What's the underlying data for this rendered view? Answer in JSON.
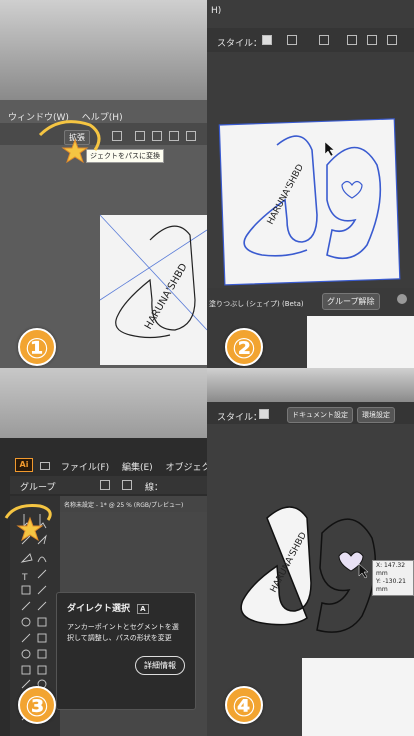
{
  "panel1": {
    "menu": [
      "ウィンドウ(W)",
      "ヘルプ(H)"
    ],
    "toolbar_button": "拡張",
    "tooltip": "ジェクトをパスに変換",
    "design_text": "HARUNA'SHBD",
    "number": "①"
  },
  "panel2": {
    "top_menu": "H)",
    "style_label": "スタイル：",
    "design_text": "HARUNA'SHBD",
    "bottom_label": "塗りつぶし (シェイプ) (Beta)",
    "ungroup_button": "グループ解除",
    "number": "②"
  },
  "panel3": {
    "menu": [
      "ファイル(F)",
      "編集(E)",
      "オブジェクト(O)"
    ],
    "group_label": "グループ",
    "doc_tab": "名称未設定 - 1* @ 25 % (RGB/プレビュー)",
    "stroke_label": "線：",
    "tooltip_title": "ダイレクト選択",
    "tooltip_key": "A",
    "tooltip_body": "アンカーポイントとセグメントを選択して調整し、パスの形状を変更",
    "tooltip_button": "詳細情報",
    "app_icon": "Ai",
    "number": "③"
  },
  "panel4": {
    "style_label": "スタイル：",
    "doc_settings_button": "ドキュメント設定",
    "prefs_button": "環境設定",
    "design_text": "HARUNA'SHBD",
    "coord_x": "X: 147.32 mm",
    "coord_y": "Y: -130.21 mm",
    "number": "④"
  },
  "colors": {
    "badge": "#f2a431",
    "path_blue": "#3a5bd0",
    "sparkle": "#f5c542"
  }
}
